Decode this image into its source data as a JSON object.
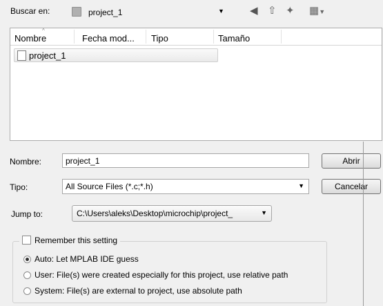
{
  "look_in": {
    "label": "Buscar en:",
    "value": "project_1"
  },
  "toolbar": {
    "back_icon": "back-arrow-icon",
    "up_icon": "up-folder-icon",
    "new_folder_icon": "new-folder-icon",
    "view_icon": "view-menu-icon"
  },
  "file_list": {
    "columns": [
      "Nombre",
      "Fecha mod...",
      "Tipo",
      "Tamaño"
    ],
    "items": [
      {
        "name": "project_1",
        "icon": "document-icon"
      }
    ]
  },
  "filename": {
    "label": "Nombre:",
    "value": "project_1"
  },
  "filetype": {
    "label": "Tipo:",
    "value": "All Source Files (*.c;*.h)"
  },
  "buttons": {
    "open": "Abrir",
    "cancel": "Cancelar"
  },
  "jump_to": {
    "label": "Jump to:",
    "value": "C:\\Users\\aleks\\Desktop\\microchip\\project_"
  },
  "settings": {
    "remember_label": "Remember this setting",
    "options": [
      {
        "label": "Auto: Let MPLAB IDE guess",
        "selected": true
      },
      {
        "label": "User: File(s) were created especially for this project, use relative path",
        "selected": false
      },
      {
        "label": "System: File(s) are external to project, use absolute path",
        "selected": false
      }
    ]
  }
}
